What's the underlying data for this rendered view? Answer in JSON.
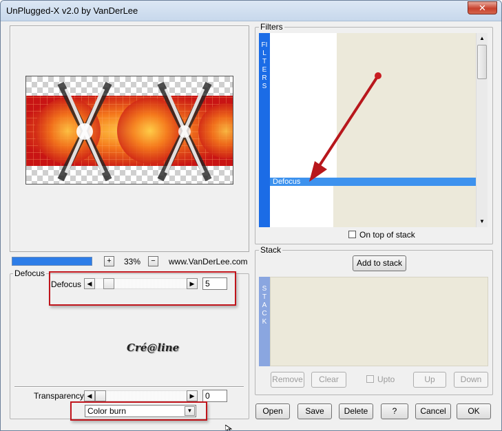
{
  "window": {
    "title": "UnPlugged-X v2.0 by VanDerLee",
    "close_glyph": "✕"
  },
  "zoom": {
    "plus": "+",
    "minus": "−",
    "level": "33%",
    "website": "www.VanDerLee.com"
  },
  "defocus_group": {
    "label": "Defocus",
    "param_label": "Defocus",
    "value": "5",
    "left_arrow": "◀",
    "right_arrow": "▶"
  },
  "watermark": "Cré@line",
  "transparency": {
    "label": "Transparency",
    "value": "0",
    "left_arrow": "◀",
    "right_arrow": "▶"
  },
  "blend_mode": {
    "selected": "Color burn",
    "chevron": "▼"
  },
  "filters": {
    "label": "Filters",
    "side_label": "FILTERS",
    "selected_item": "Defocus",
    "scroll_up": "▲",
    "scroll_down": "▼",
    "on_top_label": "On top of stack"
  },
  "stack": {
    "label": "Stack",
    "side_label": "STACK",
    "add_button": "Add to stack",
    "remove": "Remove",
    "clear": "Clear",
    "upto": "Upto",
    "up": "Up",
    "down": "Down"
  },
  "footer": {
    "open": "Open",
    "save": "Save",
    "delete": "Delete",
    "help": "?",
    "cancel": "Cancel",
    "ok": "OK"
  },
  "colors": {
    "accent_blue": "#2d7de8",
    "filter_side": "#1b6ce6",
    "stack_side": "#8aa6e0",
    "list_bg": "#ece9da",
    "annotation_red": "#c0141b"
  }
}
